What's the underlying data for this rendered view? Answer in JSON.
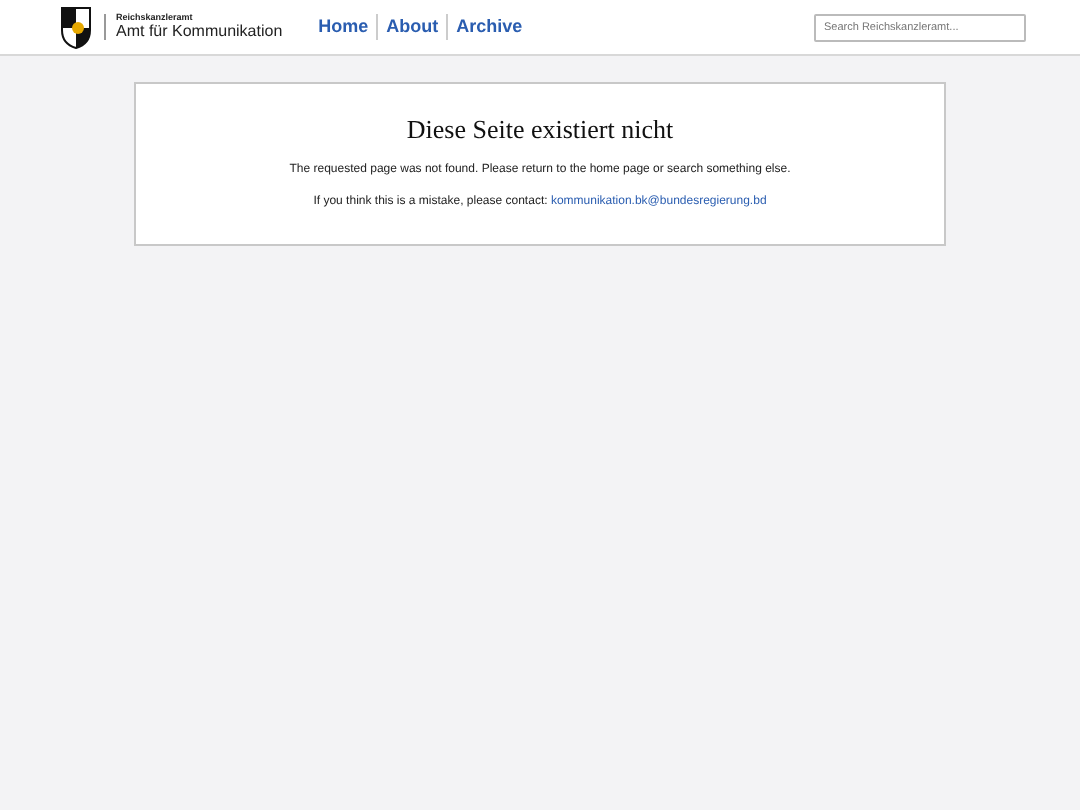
{
  "header": {
    "org_small": "Reichskanzleramt",
    "org_name": "Amt für Kommunikation",
    "nav": [
      {
        "label": "Home"
      },
      {
        "label": "About"
      },
      {
        "label": "Archive"
      }
    ],
    "search": {
      "placeholder": "Search Reichskanzleramt..."
    }
  },
  "error": {
    "title": "Diese Seite existiert nicht",
    "message": "The requested page was not found. Please return to the home page or search something else.",
    "contact_text": "If you think this is a mistake, please contact:",
    "contact_link": "kommunikation.bk@bundesregierung.bd"
  }
}
